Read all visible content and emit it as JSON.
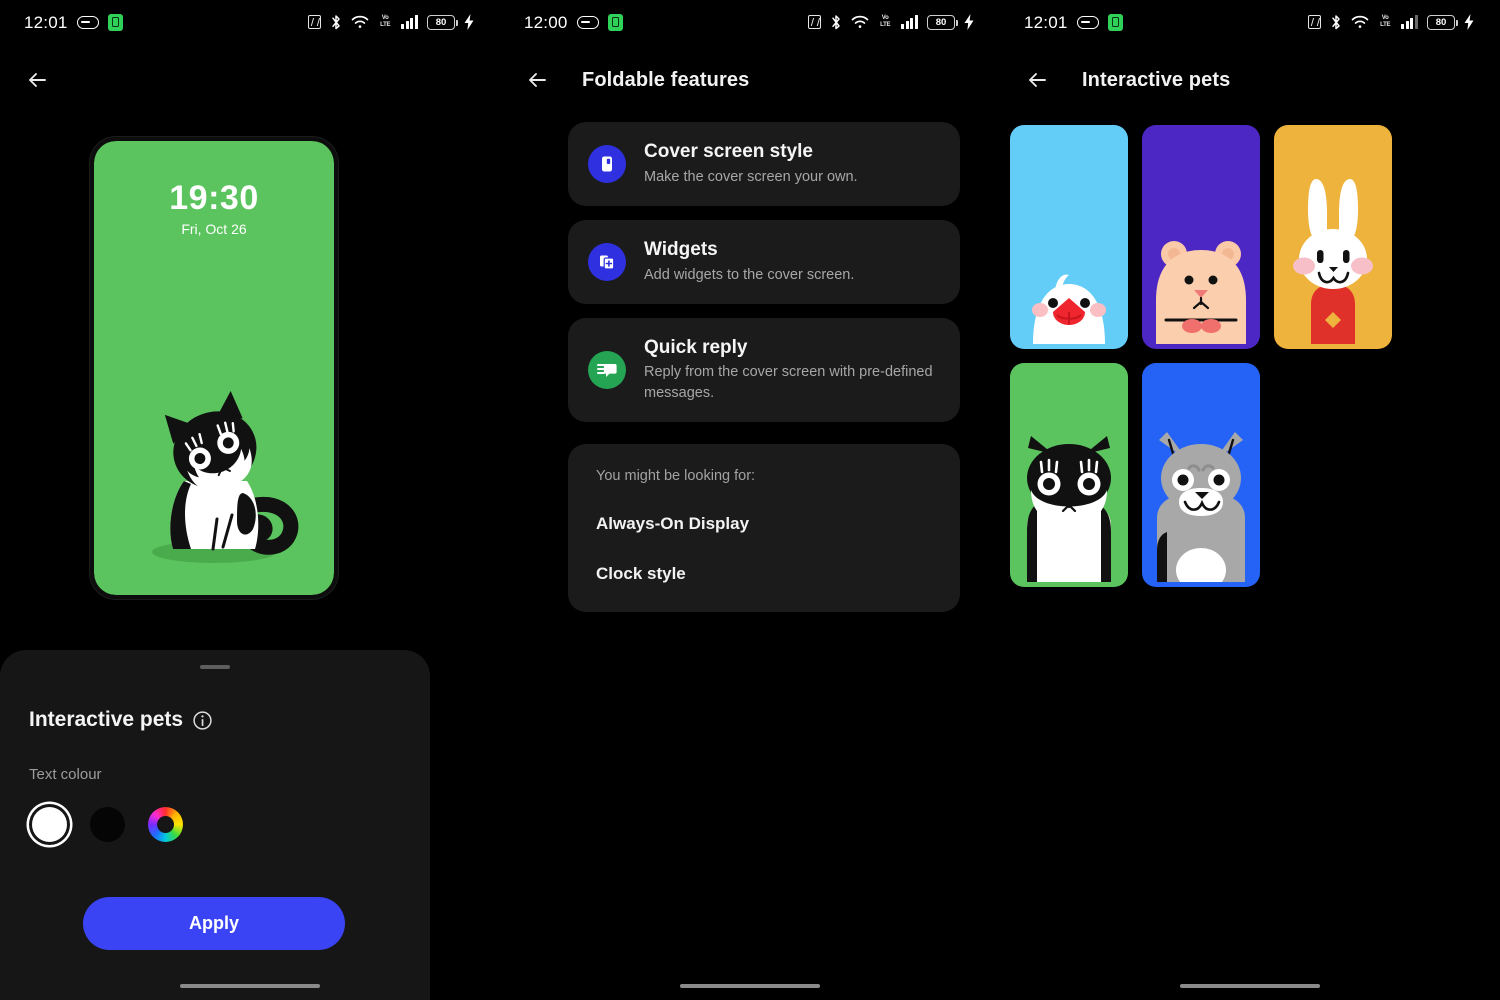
{
  "screens": [
    {
      "id": "cover-screen-preview",
      "statusbar": {
        "time": "12:01",
        "battery_level": "80",
        "icons": [
          "alarm-pill-icon",
          "battery-saver-icon",
          "nfc-icon",
          "bluetooth-icon",
          "wifi-icon",
          "volte-icon",
          "signal-icon",
          "battery-icon",
          "charging-bolt-icon"
        ]
      },
      "appbar": {
        "back_icon": "back-arrow-icon",
        "title": ""
      },
      "preview": {
        "time": "19:30",
        "date": "Fri, Oct 26",
        "background_color": "#5bc45e",
        "pet": "tuxedo-cat"
      },
      "sheet": {
        "title": "Interactive pets",
        "info_icon": "info-icon",
        "text_colour_label": "Text colour",
        "swatches": [
          {
            "name": "white",
            "color": "#ffffff",
            "selected": true
          },
          {
            "name": "black",
            "color": "#050505",
            "selected": false
          },
          {
            "name": "custom-colour-wheel",
            "color": "rainbow",
            "selected": false
          }
        ],
        "apply_label": "Apply",
        "apply_color": "#3b44f5"
      }
    },
    {
      "id": "foldable-features",
      "statusbar": {
        "time": "12:00",
        "battery_level": "80",
        "icons": [
          "alarm-pill-icon",
          "battery-saver-icon",
          "nfc-icon",
          "bluetooth-icon",
          "wifi-icon",
          "volte-icon",
          "signal-icon",
          "battery-icon",
          "charging-bolt-icon"
        ]
      },
      "appbar": {
        "back_icon": "back-arrow-icon",
        "title": "Foldable features"
      },
      "cards": [
        {
          "title": "Cover screen style",
          "desc": "Make the cover screen your own.",
          "icon": "cover-screen-icon",
          "icon_color": "#2f31e0"
        },
        {
          "title": "Widgets",
          "desc": "Add widgets to the cover screen.",
          "icon": "widgets-icon",
          "icon_color": "#2f31e0"
        },
        {
          "title": "Quick reply",
          "desc": "Reply from the cover screen with pre-defined messages.",
          "icon": "quick-reply-icon",
          "icon_color": "#25a554"
        }
      ],
      "suggestions": {
        "heading": "You might be looking for:",
        "items": [
          "Always-On Display",
          "Clock style"
        ]
      }
    },
    {
      "id": "interactive-pets",
      "statusbar": {
        "time": "12:01",
        "battery_level": "80",
        "icons": [
          "alarm-pill-icon",
          "battery-saver-icon",
          "nfc-icon",
          "bluetooth-icon",
          "wifi-icon",
          "volte-icon",
          "signal-icon",
          "battery-icon",
          "charging-bolt-icon"
        ]
      },
      "appbar": {
        "back_icon": "back-arrow-icon",
        "title": "Interactive pets"
      },
      "pets": [
        {
          "name": "java-sparrow-bird",
          "bg": "#63ccf7"
        },
        {
          "name": "hamster",
          "bg": "#4c27c4"
        },
        {
          "name": "rabbit",
          "bg": "#eeb33c"
        },
        {
          "name": "tuxedo-cat",
          "bg": "#5bc45e"
        },
        {
          "name": "husky-dog",
          "bg": "#2563f7"
        }
      ]
    }
  ]
}
